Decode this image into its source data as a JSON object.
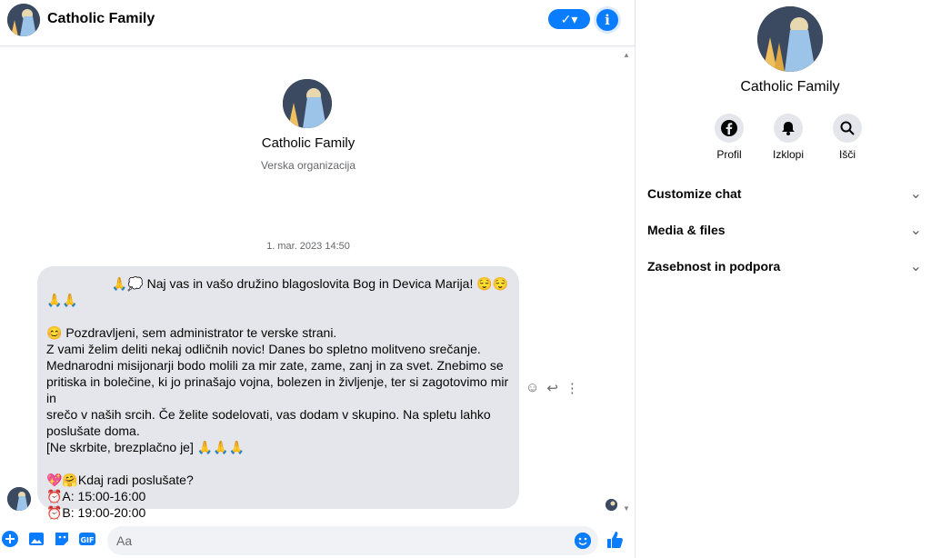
{
  "header": {
    "title": "Catholic Family",
    "check_label": "✓▾",
    "info_label": "i"
  },
  "intro": {
    "name": "Catholic Family",
    "subtitle": "Verska organizacija"
  },
  "timestamp": "1. mar. 2023 14:50",
  "message": {
    "line1": "🙏💭 Naj vas in vašo družino blagoslovita Bog in Devica Marija! 😌😌",
    "line2": "🙏🙏",
    "line3": "",
    "line4": "😊 Pozdravljeni, sem administrator te verske strani.",
    "line5": "Z vami želim deliti nekaj odličnih novic! Danes bo spletno molitveno srečanje.",
    "line6": "Mednarodni misijonarji bodo molili za mir zate, zame, zanj in za svet. Znebimo se",
    "line7": "pritiska in bolečine, ki jo prinašajo vojna, bolezen in življenje, ter si zagotovimo mir in",
    "line8": "srečo v naših srcih. Če želite sodelovati, vas dodam v skupino. Na spletu lahko",
    "line9": "poslušate doma.",
    "line10": "[Ne skrbite, brezplačno je] 🙏🙏🙏",
    "line11": "",
    "line12": "💖🤗Kdaj radi poslušate?",
    "line13": "⏰A: 15:00-16:00",
    "line14": "⏰B: 19:00-20:00"
  },
  "composer": {
    "placeholder": "Aa"
  },
  "panel": {
    "name": "Catholic Family",
    "actions": [
      {
        "label": "Profil",
        "icon": "facebook-icon"
      },
      {
        "label": "Izklopi",
        "icon": "bell-icon"
      },
      {
        "label": "Išči",
        "icon": "search-icon"
      }
    ],
    "sections": [
      "Customize chat",
      "Media & files",
      "Zasebnost in podpora"
    ]
  },
  "colors": {
    "accent": "#0a7cff",
    "bubble": "#e4e6eb"
  }
}
